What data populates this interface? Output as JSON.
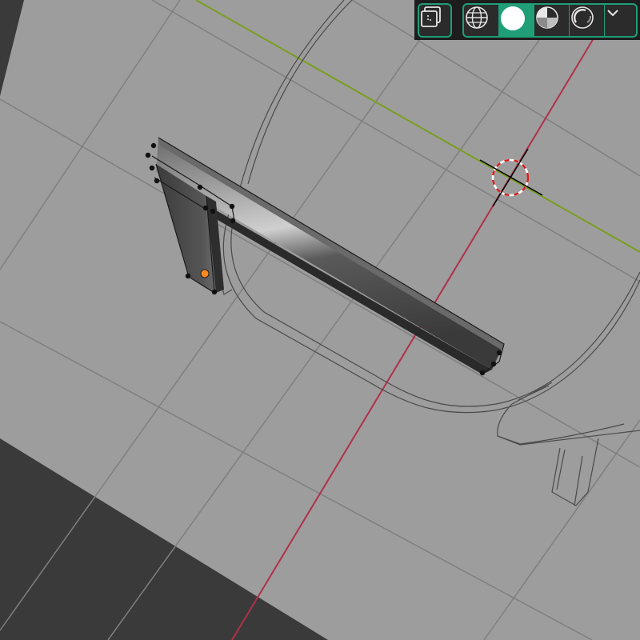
{
  "viewport": {
    "colors": {
      "background": "#3a3a3a",
      "ground_plane": "#9d9d9d",
      "grid_line": "#7f7f7f",
      "x_axis": "#b0304a",
      "y_axis": "#7a9e1e",
      "wireframe": "#4a4a4a",
      "selected_vertex": "#111111",
      "active_vertex": "#ff8a1f",
      "cursor": "#d42020"
    }
  },
  "header": {
    "overlay_toggle": {
      "icon": "overlay-icon"
    },
    "shading_modes": [
      {
        "id": "wireframe",
        "icon": "wireframe-shading-icon",
        "active": false
      },
      {
        "id": "solid",
        "icon": "solid-shading-icon",
        "active": true
      },
      {
        "id": "material",
        "icon": "material-preview-shading-icon",
        "active": false
      },
      {
        "id": "rendered",
        "icon": "rendered-shading-icon",
        "active": false
      }
    ],
    "shading_dropdown": {
      "icon": "chevron-down-icon"
    },
    "accent": "#1f9e77"
  }
}
